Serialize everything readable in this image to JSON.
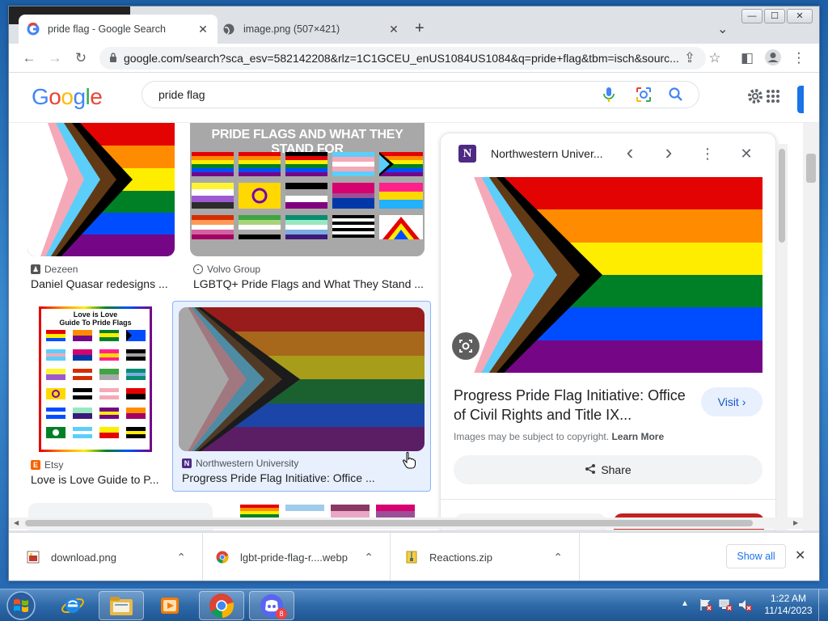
{
  "window": {
    "controls": [
      "—",
      "☐",
      "✕"
    ]
  },
  "tabs": [
    {
      "title": "pride flag - Google Search",
      "active": true,
      "close": "✕"
    },
    {
      "title": "image.png (507×421)",
      "active": false,
      "close": "✕"
    }
  ],
  "new_tab": "+",
  "tab_menu": "⌄",
  "toolbar": {
    "back": "←",
    "forward": "→",
    "reload": "↻",
    "url": "google.com/search?sca_esv=582142208&rlz=1C1GCEU_enUS1084US1084&q=pride+flag&tbm=isch&sourc...",
    "share": "⇪",
    "bookmark": "☆",
    "sidepanel": "◧",
    "menu": "⋮"
  },
  "google": {
    "logo_letters": [
      "G",
      "o",
      "o",
      "g",
      "l",
      "e"
    ],
    "logo_colors": [
      "#4285f4",
      "#ea4335",
      "#fbbc05",
      "#4285f4",
      "#34a853",
      "#ea4335"
    ],
    "query": "pride flag"
  },
  "results": [
    {
      "source": "Dezeen",
      "caption": "Daniel Quasar redesigns ...",
      "source_icon": "dezeen"
    },
    {
      "source": "Volvo Group",
      "caption": "LGBTQ+ Pride Flags and What They Stand ...",
      "source_icon": "volvo",
      "banner": "PRIDE FLAGS AND WHAT THEY STAND FOR"
    },
    {
      "source": "Etsy",
      "caption": "Love is Love Guide to P...",
      "source_icon": "etsy",
      "poster_title": "Love is Love\nGuide To Pride Flags"
    },
    {
      "source": "Northwestern University",
      "caption": "Progress Pride Flag Initiative: Office ...",
      "source_icon": "N",
      "selected": true
    }
  ],
  "panel": {
    "site": "Northwestern Univer...",
    "site_icon": "N",
    "prev": "‹",
    "next": "›",
    "more": "⋮",
    "close": "✕",
    "title": "Progress Pride Flag Initiative: Office of Civil Rights and Title IX...",
    "visit_label": "Visit ›",
    "copyright_note": "Images may be subject to copyright.",
    "learn_more": "Learn More",
    "share_label": "Share"
  },
  "downloads": [
    {
      "name": "download.png",
      "chevron": "⌃"
    },
    {
      "name": "lgbt-pride-flag-r....webp",
      "chevron": "⌃"
    },
    {
      "name": "Reactions.zip",
      "chevron": "⌃"
    }
  ],
  "show_all": "Show all",
  "dl_close": "✕",
  "taskbar": {
    "discord_badge": "8",
    "time": "1:22 AM",
    "date": "11/14/2023"
  },
  "colors": {
    "rainbow": [
      "#e40303",
      "#ff8c00",
      "#ffed00",
      "#008026",
      "#004dff",
      "#750787"
    ],
    "trans": [
      "#5bcefa",
      "#f5a9b8",
      "#ffffff"
    ],
    "chevron": [
      "#000000",
      "#613915"
    ]
  }
}
